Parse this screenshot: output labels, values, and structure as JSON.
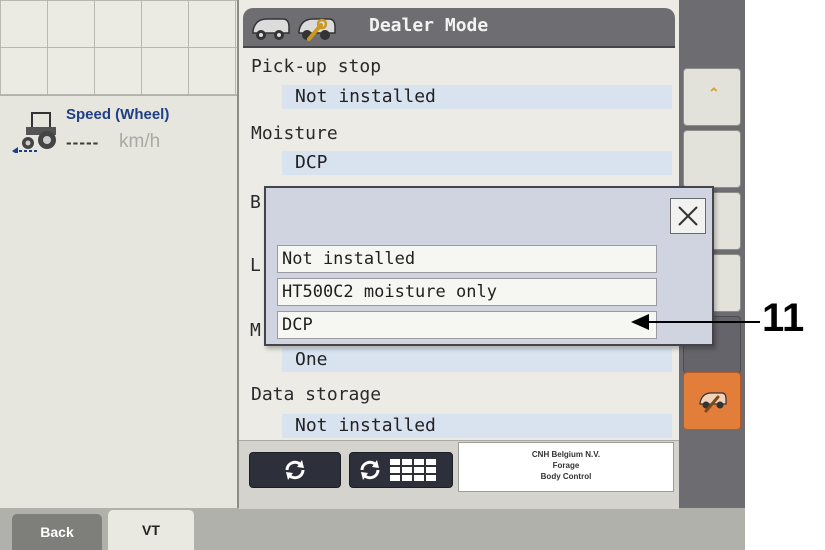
{
  "left_panel": {
    "speed_label": "Speed (Wheel)",
    "speed_value": "-----",
    "speed_unit": "km/h"
  },
  "tabs": {
    "back": "Back",
    "vt": "VT"
  },
  "header": {
    "title": "Dealer Mode"
  },
  "settings": {
    "pickup_stop_label": "Pick-up stop",
    "pickup_stop_value": "Not installed",
    "moisture_label": "Moisture",
    "moisture_value": "DCP",
    "stub_b": "B",
    "stub_l": "L",
    "stub_m": "M",
    "partial_value": "One",
    "data_storage_label": "Data storage",
    "data_storage_value": "Not installed"
  },
  "popup": {
    "options": [
      "Not installed",
      "HT500C2 moisture only",
      "DCP"
    ]
  },
  "company": {
    "line1": "CNH Belgium N.V.",
    "line2": "Forage",
    "line3": "Body Control"
  },
  "callout": {
    "number": "11"
  },
  "colors": {
    "header_bg": "#6e6e72",
    "value_bg": "#d9e3f0",
    "speed_label": "#1f3f86",
    "orange_button": "#e37d3a",
    "scroll_chevron": "#d2a52b"
  }
}
